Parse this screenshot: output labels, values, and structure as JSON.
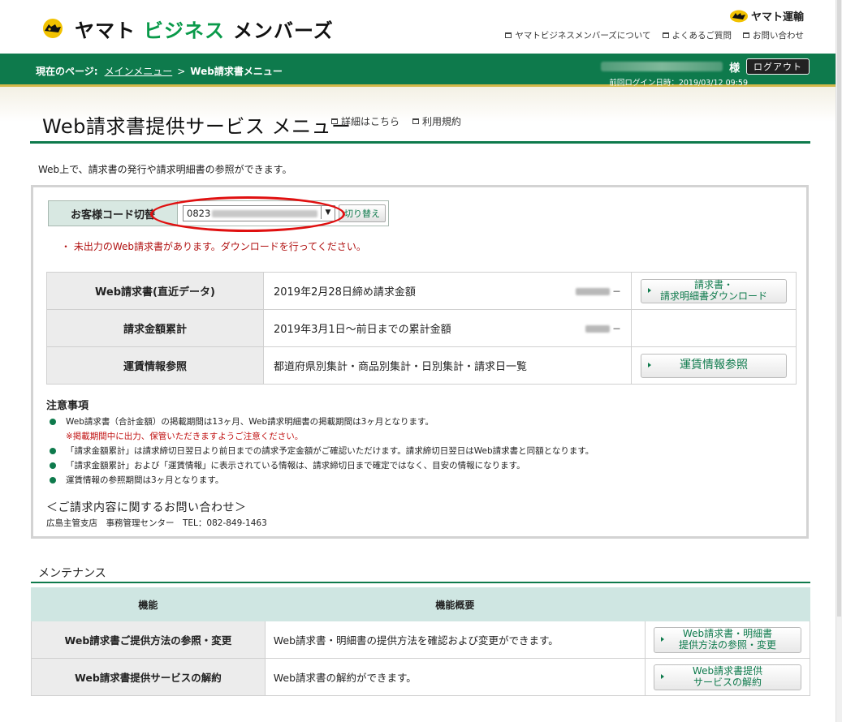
{
  "header": {
    "logo_part1": "ヤマト",
    "logo_part2": "ビジネス",
    "logo_part3": "メンバーズ",
    "corp_logo": "ヤマト運輸",
    "links": [
      "ヤマトビジネスメンバーズについて",
      "よくあるご質問",
      "お問い合わせ"
    ]
  },
  "navbar": {
    "crumb_label": "現在のページ:",
    "crumb_main": "メインメニュー",
    "crumb_sep": ">",
    "crumb_current": "Web請求書メニュー",
    "user_suffix": "様",
    "logout": "ログアウト",
    "last_login": "前回ログイン日時：2019/03/12 09:59"
  },
  "page": {
    "title": "Web請求書提供サービス メニュー",
    "title_links": [
      "詳細はこちら",
      "利用規約"
    ],
    "intro": "Web上で、請求書の発行や請求明細書の参照ができます。"
  },
  "customer": {
    "label": "お客様コード切替",
    "select_value": "0823",
    "switch_button": "切り替え",
    "notice": "・ 未出力のWeb請求書があります。ダウンロードを行ってください。"
  },
  "summary_rows": [
    {
      "head": "Web請求書(直近データ)",
      "desc": "2019年2月28日締め請求金額",
      "amount_suffix": "－",
      "button_line1": "請求書・",
      "button_line2": "請求明細書ダウンロード"
    },
    {
      "head": "請求金額累計",
      "desc": "2019年3月1日～前日までの累計金額",
      "amount_suffix": "－"
    },
    {
      "head": "運賃情報参照",
      "desc": "都道府県別集計・商品別集計・日別集計・請求日一覧",
      "button": "運賃情報参照"
    }
  ],
  "notes": {
    "title": "注意事項",
    "items": [
      {
        "text": "Web請求書（合計金額）の掲載期間は13ヶ月、Web請求明細書の掲載期間は3ヶ月となります。",
        "sub": "※掲載期間中に出力、保管いただきますようご注意ください。"
      },
      {
        "text": "「請求金額累計」は請求締切日翌日より前日までの請求予定金額がご確認いただけます。請求締切日翌日はWeb請求書と同額となります。"
      },
      {
        "text": "「請求金額累計」および「運賃情報」に表示されている情報は、請求締切日まで確定ではなく、目安の情報になります。"
      },
      {
        "text": "運賃情報の参照期間は3ヶ月となります。"
      }
    ]
  },
  "contact": {
    "title": "＜ご請求内容に関するお問い合わせ＞",
    "line": "広島主管支店　事務管理センター　TEL：082-849-1463"
  },
  "maintenance": {
    "title": "メンテナンス",
    "col_function": "機能",
    "col_summary": "機能概要",
    "rows": [
      {
        "head": "Web請求書ご提供方法の参照・変更",
        "desc": "Web請求書・明細書の提供方法を確認および変更ができます。",
        "button_line1": "Web請求書・明細書",
        "button_line2": "提供方法の参照・変更"
      },
      {
        "head": "Web請求書提供サービスの解約",
        "desc": "Web請求書の解約ができます。",
        "button_line1": "Web請求書提供",
        "button_line2": "サービスの解約"
      }
    ]
  }
}
